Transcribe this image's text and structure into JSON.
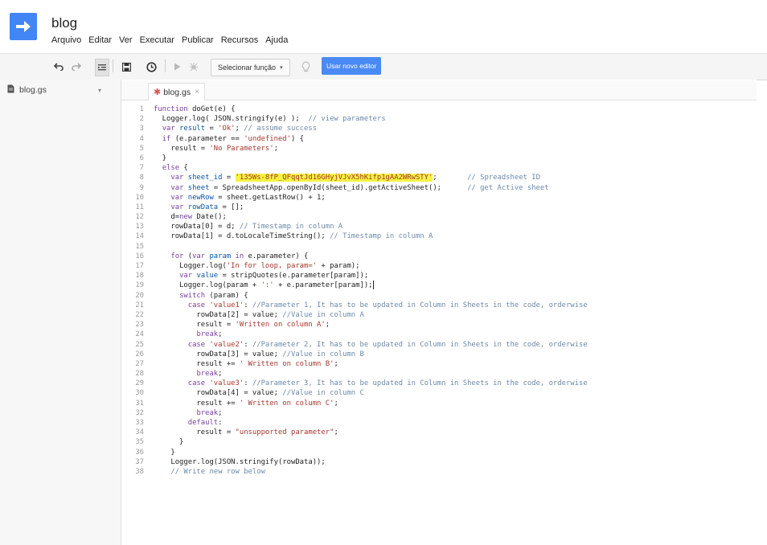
{
  "app": {
    "title": "blog",
    "menu": [
      "Arquivo",
      "Editar",
      "Ver",
      "Executar",
      "Publicar",
      "Recursos",
      "Ajuda"
    ],
    "toolbar": {
      "select_function": "Selecionar função",
      "new_editor": "Usar novo editor"
    },
    "sidebar": {
      "file_name": "blog.gs"
    },
    "tab": {
      "name": "blog.gs",
      "close": "×"
    }
  },
  "code_lines": [
    {
      "n": "1",
      "t": "function doGet(e) {"
    },
    {
      "n": "2",
      "t": "  Logger.log( JSON.stringify(e) );  // view parameters"
    },
    {
      "n": "3",
      "t": "  var result = 'Ok'; // assume success"
    },
    {
      "n": "4",
      "t": "  if (e.parameter == 'undefined') {"
    },
    {
      "n": "5",
      "t": "    result = 'No Parameters';"
    },
    {
      "n": "6",
      "t": "  }"
    },
    {
      "n": "7",
      "t": "  else {"
    },
    {
      "n": "8",
      "t": "    var sheet_id = '135Ws-8fP_QFqqtJd16GHyjVJvX5hKifp1gAA2WRwSTY';       // Spreadsheet ID"
    },
    {
      "n": "9",
      "t": "    var sheet = SpreadsheetApp.openById(sheet_id).getActiveSheet();      // get Active sheet"
    },
    {
      "n": "10",
      "t": "    var newRow = sheet.getLastRow() + 1;"
    },
    {
      "n": "11",
      "t": "    var rowData = [];"
    },
    {
      "n": "12",
      "t": "    d=new Date();"
    },
    {
      "n": "13",
      "t": "    rowData[0] = d; // Timestamp in column A"
    },
    {
      "n": "14",
      "t": "    rowData[1] = d.toLocaleTimeString(); // Timestamp in column A"
    },
    {
      "n": "15",
      "t": ""
    },
    {
      "n": "16",
      "t": "    for (var param in e.parameter) {"
    },
    {
      "n": "17",
      "t": "      Logger.log('In for loop, param=' + param);"
    },
    {
      "n": "18",
      "t": "      var value = stripQuotes(e.parameter[param]);"
    },
    {
      "n": "19",
      "t": "      Logger.log(param + ':' + e.parameter[param]);"
    },
    {
      "n": "20",
      "t": "      switch (param) {"
    },
    {
      "n": "21",
      "t": "        case 'value1': //Parameter 1, It has to be updated in Column in Sheets in the code, orderwise"
    },
    {
      "n": "22",
      "t": "          rowData[2] = value; //Value in column A"
    },
    {
      "n": "23",
      "t": "          result = 'Written on column A';"
    },
    {
      "n": "24",
      "t": "          break;"
    },
    {
      "n": "25",
      "t": "        case 'value2': //Parameter 2, It has to be updated in Column in Sheets in the code, orderwise"
    },
    {
      "n": "26",
      "t": "          rowData[3] = value; //Value in column B"
    },
    {
      "n": "27",
      "t": "          result += ' Written on column B';"
    },
    {
      "n": "28",
      "t": "          break;"
    },
    {
      "n": "29",
      "t": "        case 'value3': //Parameter 3, It has to be updated in Column in Sheets in the code, orderwise"
    },
    {
      "n": "30",
      "t": "          rowData[4] = value; //Value in column C"
    },
    {
      "n": "31",
      "t": "          result += ' Written on column C';"
    },
    {
      "n": "32",
      "t": "          break;"
    },
    {
      "n": "33",
      "t": "        default:"
    },
    {
      "n": "34",
      "t": "          result = \"unsupported parameter\";"
    },
    {
      "n": "35",
      "t": "      }"
    },
    {
      "n": "36",
      "t": "    }"
    },
    {
      "n": "37",
      "t": "    Logger.log(JSON.stringify(rowData));"
    },
    {
      "n": "38",
      "t": "    // Write new row below"
    }
  ],
  "colors": {
    "accent": "#4285f4",
    "highlight": "#f6f342"
  }
}
